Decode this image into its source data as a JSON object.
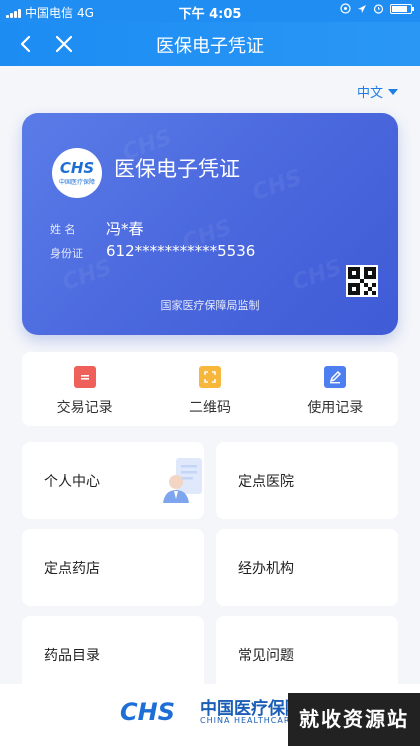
{
  "status_bar": {
    "carrier": "中国电信",
    "network": "4G",
    "time": "下午 4:05"
  },
  "nav": {
    "title": "医保电子凭证"
  },
  "language": {
    "label": "中文"
  },
  "card": {
    "logo_text": "CHS",
    "logo_sub": "中国医疗保障",
    "title": "医保电子凭证",
    "name_label": "姓  名",
    "name_value": "冯*春",
    "id_label": "身份证",
    "id_value": "612***********5536",
    "supervision": "国家医疗保障局监制",
    "watermark_text": "CHS"
  },
  "actions": [
    {
      "label": "交易记录",
      "icon": "document-icon",
      "color": "#f0605a"
    },
    {
      "label": "二维码",
      "icon": "qr-scan-icon",
      "color": "#f6b73c"
    },
    {
      "label": "使用记录",
      "icon": "edit-icon",
      "color": "#4d7ff0"
    }
  ],
  "tiles": {
    "personal_center": "个人中心",
    "designated_hospital": "定点医院",
    "designated_pharmacy": "定点药店",
    "agency": "经办机构",
    "drug_catalog": "药品目录",
    "faq": "常见问题"
  },
  "footer": {
    "logo": "CHS",
    "name_cn": "中国医疗保障",
    "name_en": "CHINA HEALTHCARE SECURITY"
  },
  "overlay_watermark": "就收资源站",
  "colors": {
    "primary": "#1f8df2",
    "card": "#4a67dd",
    "background": "#f4f6fa"
  }
}
